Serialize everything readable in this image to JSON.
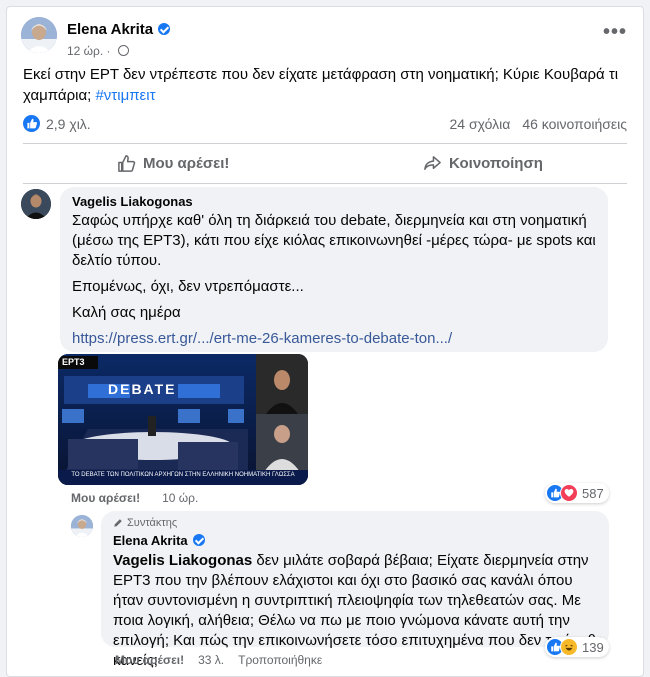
{
  "post": {
    "author": "Elena Akrita",
    "time": "12 ώρ.",
    "text": "Εκεί στην ΕΡΤ δεν ντρέπεστε που δεν είχατε μετάφραση στη νοηματική;  Κύριε Κουβαρά τι χαμπάρια; ",
    "hashtag": "#ντιμπειτ",
    "reactions_count": "2,9 χιλ.",
    "comments_count": "24 σχόλια",
    "shares_count": "46 κοινοποιήσεις",
    "like_label": "Μου αρέσει!",
    "share_label": "Κοινοποίηση"
  },
  "comment1": {
    "author": "Vagelis Liakogonas",
    "para1": "Σαφώς υπήρχε καθ' όλη τη διάρκειά του debate, διερμηνεία και στη νοηματική (μέσω της ΕΡΤ3), κάτι που είχε κιόλας επικοινωνηθεί -μέρες τώρα- με spots και δελτίο τύπου.",
    "para2": "Επομένως, όχι, δεν ντρεπόμαστε...",
    "para3": "Καλή σας ημέρα",
    "link": "https://press.ert.gr/.../ert-me-26-kameres-to-debate-ton.../",
    "image": {
      "channel": "ΕΡΤ3",
      "banner": "DEBATE",
      "caption": "ΤΟ DEBATE ΤΩΝ ΠΟΛΙΤΙΚΩΝ ΑΡΧΗΓΩΝ ΣΤΗΝ ΕΛΛΗΝΙΚΗ ΝΟΗΜΑΤΙΚΗ ΓΛΩΣΣΑ"
    },
    "like_label": "Μου αρέσει!",
    "time": "10 ώρ.",
    "reactions": "587"
  },
  "reply": {
    "badge": "Συντάκτης",
    "author": "Elena Akrita",
    "mention": "Vagelis Liakogonas",
    "text": " δεν μιλάτε σοβαρά βέβαια; Είχατε διερμηνεία στην ΕΡΤ3 που την βλέπουν ελάχιστοι και όχι στο βασικό σας κανάλι όπου ήταν συντονισμένη η συντριπτική πλειοψηφία των τηλεθεατών σας. Με ποια λογική, αλήθεια; Θέλω να πω με ποιο γνώμονα κάνατε αυτή την επιλογή; Και πώς την επικοινωνήσετε τόσο επιτυχημένα που δεν το έμαθε κανείς;",
    "like_label": "Μου αρέσει!",
    "time": "33 λ.",
    "edited": "Τροποποιήθηκε",
    "reactions": "139"
  },
  "colors": {
    "accent": "#1877f2",
    "link": "#385898",
    "bubble": "#f0f2f5",
    "muted": "#65676b"
  }
}
